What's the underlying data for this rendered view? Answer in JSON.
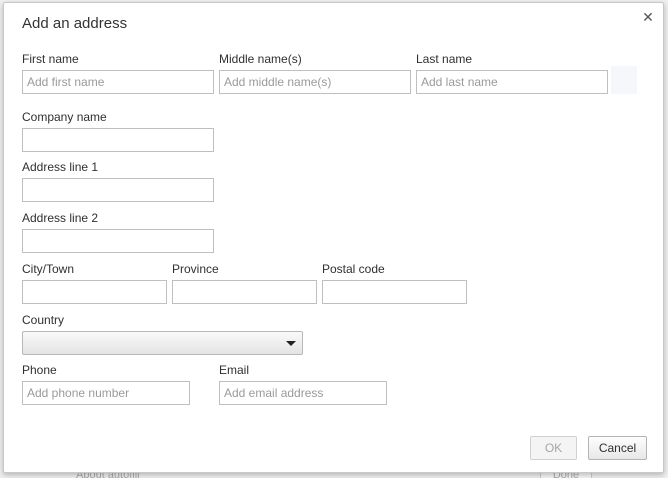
{
  "dialog": {
    "title": "Add an address",
    "close_icon": "close-icon"
  },
  "fields": {
    "first_name": {
      "label": "First name",
      "placeholder": "Add first name",
      "value": ""
    },
    "middle_name": {
      "label": "Middle name(s)",
      "placeholder": "Add middle name(s)",
      "value": ""
    },
    "last_name": {
      "label": "Last name",
      "placeholder": "Add last name",
      "value": ""
    },
    "company": {
      "label": "Company name",
      "placeholder": "",
      "value": ""
    },
    "address1": {
      "label": "Address line 1",
      "placeholder": "",
      "value": ""
    },
    "address2": {
      "label": "Address line 2",
      "placeholder": "",
      "value": ""
    },
    "city": {
      "label": "City/Town",
      "placeholder": "",
      "value": ""
    },
    "province": {
      "label": "Province",
      "placeholder": "",
      "value": ""
    },
    "postal": {
      "label": "Postal code",
      "placeholder": "",
      "value": ""
    },
    "country": {
      "label": "Country",
      "selected": ""
    },
    "phone": {
      "label": "Phone",
      "placeholder": "Add phone number",
      "value": ""
    },
    "email": {
      "label": "Email",
      "placeholder": "Add email address",
      "value": ""
    }
  },
  "buttons": {
    "ok": "OK",
    "cancel": "Cancel"
  },
  "background": {
    "about_text": "About autofill",
    "done_label": "Done"
  }
}
